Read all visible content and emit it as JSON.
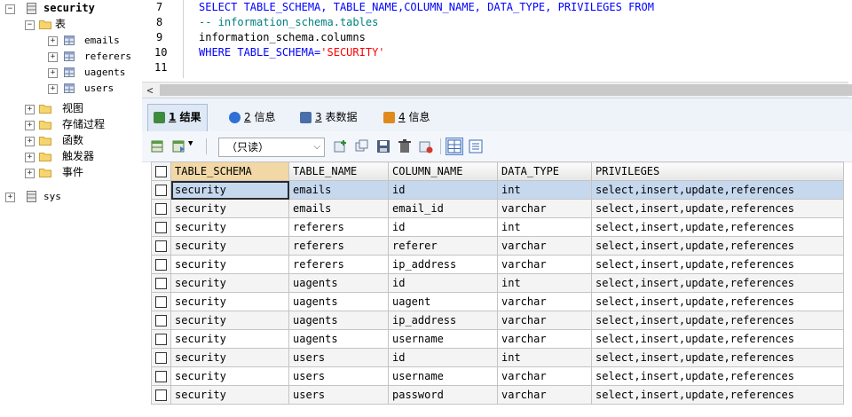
{
  "tree": {
    "database": "security",
    "tables_folder": "表",
    "tables": [
      "emails",
      "referers",
      "uagents",
      "users"
    ],
    "folders": [
      "视图",
      "存储过程",
      "函数",
      "触发器",
      "事件"
    ],
    "other_db": "sys"
  },
  "editor": {
    "line_numbers": [
      "7",
      "8",
      "9",
      "10",
      "11"
    ],
    "line7": {
      "kw": "SELECT",
      "rest": " TABLE_SCHEMA, TABLE_NAME,COLUMN_NAME, DATA_TYPE, PRIVILEGES ",
      "kw2": "FROM"
    },
    "line8": "-- information_schema.tables",
    "line9": "information_schema.columns",
    "line10": {
      "kw": "WHERE",
      "rest": " TABLE_SCHEMA=",
      "str": "'SECURITY'"
    },
    "scroll_left_glyph": "<"
  },
  "tabs": [
    {
      "num": "1",
      "label": "结果"
    },
    {
      "num": "2",
      "label": "信息"
    },
    {
      "num": "3",
      "label": "表数据"
    },
    {
      "num": "4",
      "label": "信息"
    }
  ],
  "toolbar": {
    "mode_select": "（只读）"
  },
  "grid": {
    "columns": [
      "TABLE_SCHEMA",
      "TABLE_NAME",
      "COLUMN_NAME",
      "DATA_TYPE",
      "PRIVILEGES"
    ],
    "rows": [
      [
        "security",
        "emails",
        "id",
        "int",
        "select,insert,update,references"
      ],
      [
        "security",
        "emails",
        "email_id",
        "varchar",
        "select,insert,update,references"
      ],
      [
        "security",
        "referers",
        "id",
        "int",
        "select,insert,update,references"
      ],
      [
        "security",
        "referers",
        "referer",
        "varchar",
        "select,insert,update,references"
      ],
      [
        "security",
        "referers",
        "ip_address",
        "varchar",
        "select,insert,update,references"
      ],
      [
        "security",
        "uagents",
        "id",
        "int",
        "select,insert,update,references"
      ],
      [
        "security",
        "uagents",
        "uagent",
        "varchar",
        "select,insert,update,references"
      ],
      [
        "security",
        "uagents",
        "ip_address",
        "varchar",
        "select,insert,update,references"
      ],
      [
        "security",
        "uagents",
        "username",
        "varchar",
        "select,insert,update,references"
      ],
      [
        "security",
        "users",
        "id",
        "int",
        "select,insert,update,references"
      ],
      [
        "security",
        "users",
        "username",
        "varchar",
        "select,insert,update,references"
      ],
      [
        "security",
        "users",
        "password",
        "varchar",
        "select,insert,update,references"
      ]
    ]
  },
  "colors": {
    "keyword": "#0000ff",
    "comment": "#008080",
    "string": "#ff0000",
    "selected_row": "#c6d8ee",
    "sorted_header": "#f2d8a6"
  }
}
